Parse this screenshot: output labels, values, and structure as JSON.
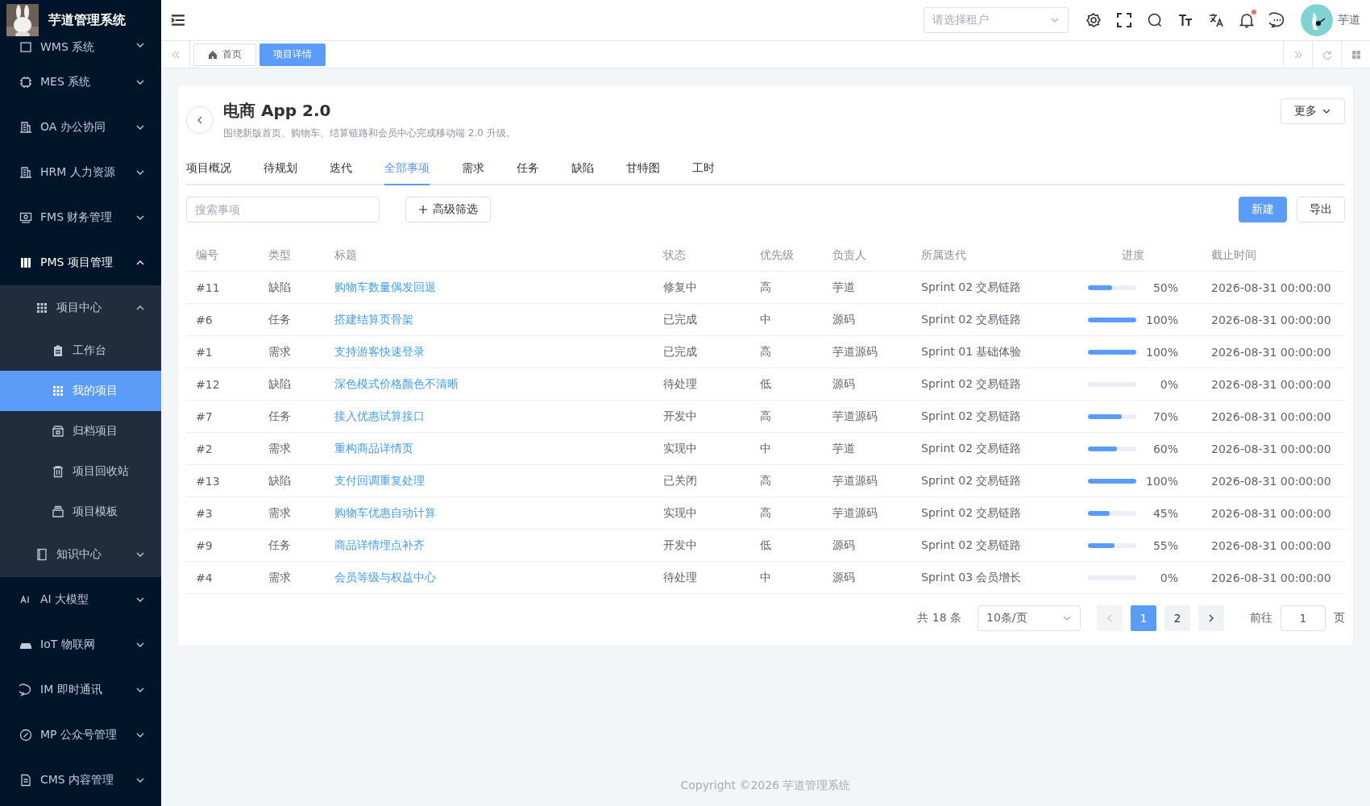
{
  "app": {
    "title": "芋道管理系统"
  },
  "sidebar": {
    "items": [
      {
        "label": "WMS 系统",
        "expanded": false,
        "selected": false
      },
      {
        "label": "MES 系统",
        "expanded": false,
        "selected": false
      },
      {
        "label": "OA 办公协同",
        "expanded": false,
        "selected": false
      },
      {
        "label": "HRM 人力资源",
        "expanded": false,
        "selected": false
      },
      {
        "label": "FMS 财务管理",
        "expanded": false,
        "selected": false
      },
      {
        "label": "PMS 项目管理",
        "expanded": true,
        "selected": false,
        "children": [
          {
            "label": "项目中心",
            "expanded": true,
            "selected": false,
            "children": [
              {
                "label": "工作台",
                "selected": false
              },
              {
                "label": "我的项目",
                "selected": true
              },
              {
                "label": "归档项目",
                "selected": false
              },
              {
                "label": "项目回收站",
                "selected": false
              },
              {
                "label": "项目模板",
                "selected": false
              }
            ]
          },
          {
            "label": "知识中心",
            "expanded": false,
            "selected": false
          }
        ]
      },
      {
        "label": "AI 大模型",
        "expanded": false,
        "selected": false
      },
      {
        "label": "IoT 物联网",
        "expanded": false,
        "selected": false
      },
      {
        "label": "IM 即时通讯",
        "expanded": false,
        "selected": false
      },
      {
        "label": "MP 公众号管理",
        "expanded": false,
        "selected": false
      },
      {
        "label": "CMS 内容管理",
        "expanded": false,
        "selected": false
      }
    ]
  },
  "header": {
    "tenant_select": {
      "placeholder": "请选择租户"
    },
    "notifications_unread": true,
    "user": "芋道"
  },
  "tags_view": [
    {
      "label": "首页",
      "selected": false
    },
    {
      "label": "项目详情",
      "selected": true
    }
  ],
  "project": {
    "title": "电商 App 2.0",
    "description": "围绕新版首页、购物车、结算链路和会员中心完成移动端 2.0 升级。",
    "more_button": "更多"
  },
  "tabs": [
    {
      "label": "项目概况",
      "selected": false
    },
    {
      "label": "待规划",
      "selected": false
    },
    {
      "label": "迭代",
      "selected": false
    },
    {
      "label": "全部事项",
      "selected": true
    },
    {
      "label": "需求",
      "selected": false
    },
    {
      "label": "任务",
      "selected": false
    },
    {
      "label": "缺陷",
      "selected": false
    },
    {
      "label": "甘特图",
      "selected": false
    },
    {
      "label": "工时",
      "selected": false
    }
  ],
  "toolbar": {
    "search": {
      "placeholder": "搜索事项"
    },
    "filter_button": "高级筛选",
    "new_button": "新建",
    "export_button": "导出"
  },
  "table": {
    "columns": [
      "编号",
      "类型",
      "标题",
      "状态",
      "优先级",
      "负责人",
      "所属迭代",
      "进度",
      "截止时间"
    ],
    "rows": [
      {
        "id": "#11",
        "type": "缺陷",
        "title": "购物车数量偶发回退",
        "status": "修复中",
        "priority": "高",
        "owner": "芋道",
        "iteration": "Sprint 02 交易链路",
        "level": 0.5,
        "progress": "50%",
        "deadline": "2026-08-31 00:00:00"
      },
      {
        "id": "#6",
        "type": "任务",
        "title": "搭建结算页骨架",
        "status": "已完成",
        "priority": "中",
        "owner": "源码",
        "iteration": "Sprint 02 交易链路",
        "level": 1,
        "progress": "100%",
        "deadline": "2026-08-31 00:00:00"
      },
      {
        "id": "#1",
        "type": "需求",
        "title": "支持游客快速登录",
        "status": "已完成",
        "priority": "高",
        "owner": "芋道源码",
        "iteration": "Sprint 01 基础体验",
        "level": 1,
        "progress": "100%",
        "deadline": "2026-08-31 00:00:00"
      },
      {
        "id": "#12",
        "type": "缺陷",
        "title": "深色模式价格颜色不清晰",
        "status": "待处理",
        "priority": "低",
        "owner": "源码",
        "iteration": "Sprint 02 交易链路",
        "level": 0,
        "progress": "0%",
        "deadline": "2026-08-31 00:00:00"
      },
      {
        "id": "#7",
        "type": "任务",
        "title": "接入优惠试算接口",
        "status": "开发中",
        "priority": "高",
        "owner": "芋道源码",
        "iteration": "Sprint 02 交易链路",
        "level": 0.7,
        "progress": "70%",
        "deadline": "2026-08-31 00:00:00"
      },
      {
        "id": "#2",
        "type": "需求",
        "title": "重构商品详情页",
        "status": "实现中",
        "priority": "中",
        "owner": "芋道",
        "iteration": "Sprint 02 交易链路",
        "level": 0.6,
        "progress": "60%",
        "deadline": "2026-08-31 00:00:00"
      },
      {
        "id": "#13",
        "type": "缺陷",
        "title": "支付回调重复处理",
        "status": "已关闭",
        "priority": "高",
        "owner": "芋道源码",
        "iteration": "Sprint 02 交易链路",
        "level": 1,
        "progress": "100%",
        "deadline": "2026-08-31 00:00:00"
      },
      {
        "id": "#3",
        "type": "需求",
        "title": "购物车优惠自动计算",
        "status": "实现中",
        "priority": "高",
        "owner": "芋道源码",
        "iteration": "Sprint 02 交易链路",
        "level": 0.45,
        "progress": "45%",
        "deadline": "2026-08-31 00:00:00"
      },
      {
        "id": "#9",
        "type": "任务",
        "title": "商品详情埋点补齐",
        "status": "开发中",
        "priority": "低",
        "owner": "源码",
        "iteration": "Sprint 02 交易链路",
        "level": 0.55,
        "progress": "55%",
        "deadline": "2026-08-31 00:00:00"
      },
      {
        "id": "#4",
        "type": "需求",
        "title": "会员等级与权益中心",
        "status": "待处理",
        "priority": "中",
        "owner": "源码",
        "iteration": "Sprint 03 会员增长",
        "level": 0,
        "progress": "0%",
        "deadline": "2026-08-31 00:00:00"
      }
    ]
  },
  "pagination": {
    "total": "共 18 条",
    "page_size": "10条/页",
    "prev_disabled": true,
    "pages": [
      {
        "label": "1",
        "selected": true
      },
      {
        "label": "2",
        "selected": false
      }
    ],
    "goto_label": "前往",
    "goto_value": "1",
    "goto_suffix": "页"
  },
  "footer": "Copyright ©2026 芋道管理系统"
}
